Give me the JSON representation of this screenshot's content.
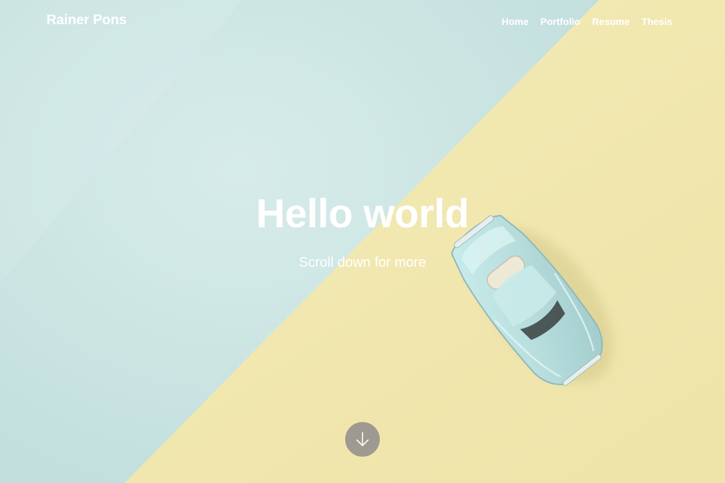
{
  "site": {
    "brand": "Rainer Pons"
  },
  "nav": {
    "items": [
      {
        "label": "Home"
      },
      {
        "label": "Portfolio"
      },
      {
        "label": "Resume"
      },
      {
        "label": "Thesis"
      }
    ]
  },
  "hero": {
    "title": "Hello world",
    "subtitle": "Scroll down for more",
    "background_image": "toy-car-image",
    "scroll_icon": "arrow-down-icon",
    "colors": {
      "blue": "#c8e2e1",
      "yellow": "#f0e7b3",
      "car": "#b9dddd",
      "scroll_button": "#9e9991"
    }
  }
}
